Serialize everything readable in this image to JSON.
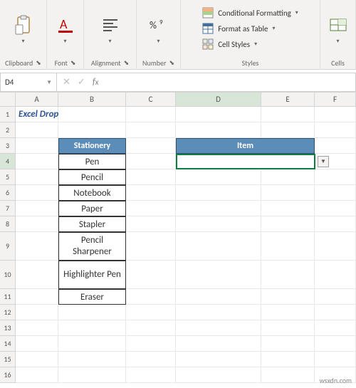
{
  "ribbon": {
    "clipboard": {
      "label": "Clipboard"
    },
    "font": {
      "label": "Font"
    },
    "alignment": {
      "label": "Alignment"
    },
    "number": {
      "label": "Number"
    },
    "styles": {
      "label": "Styles",
      "conditional": "Conditional Formatting",
      "table": "Format as Table",
      "cellstyles": "Cell Styles"
    },
    "cells": {
      "label": "Cells"
    }
  },
  "namebox": {
    "value": "D4"
  },
  "formula": {
    "value": ""
  },
  "sheet": {
    "title": "Excel Drop Down List Multiple Selection",
    "col_headers": {
      "A": "A",
      "B": "B",
      "C": "C",
      "D": "D",
      "E": "E",
      "F": "F"
    },
    "stationery_header": "Stationery",
    "item_header": "Item",
    "stationery": [
      "Pen",
      "Pencil",
      "Notebook",
      "Paper",
      "Stapler",
      "Pencil Sharpener",
      "Highlighter Pen",
      "Eraser"
    ],
    "dropdown_value": ""
  },
  "watermark": "wsxdn.com"
}
